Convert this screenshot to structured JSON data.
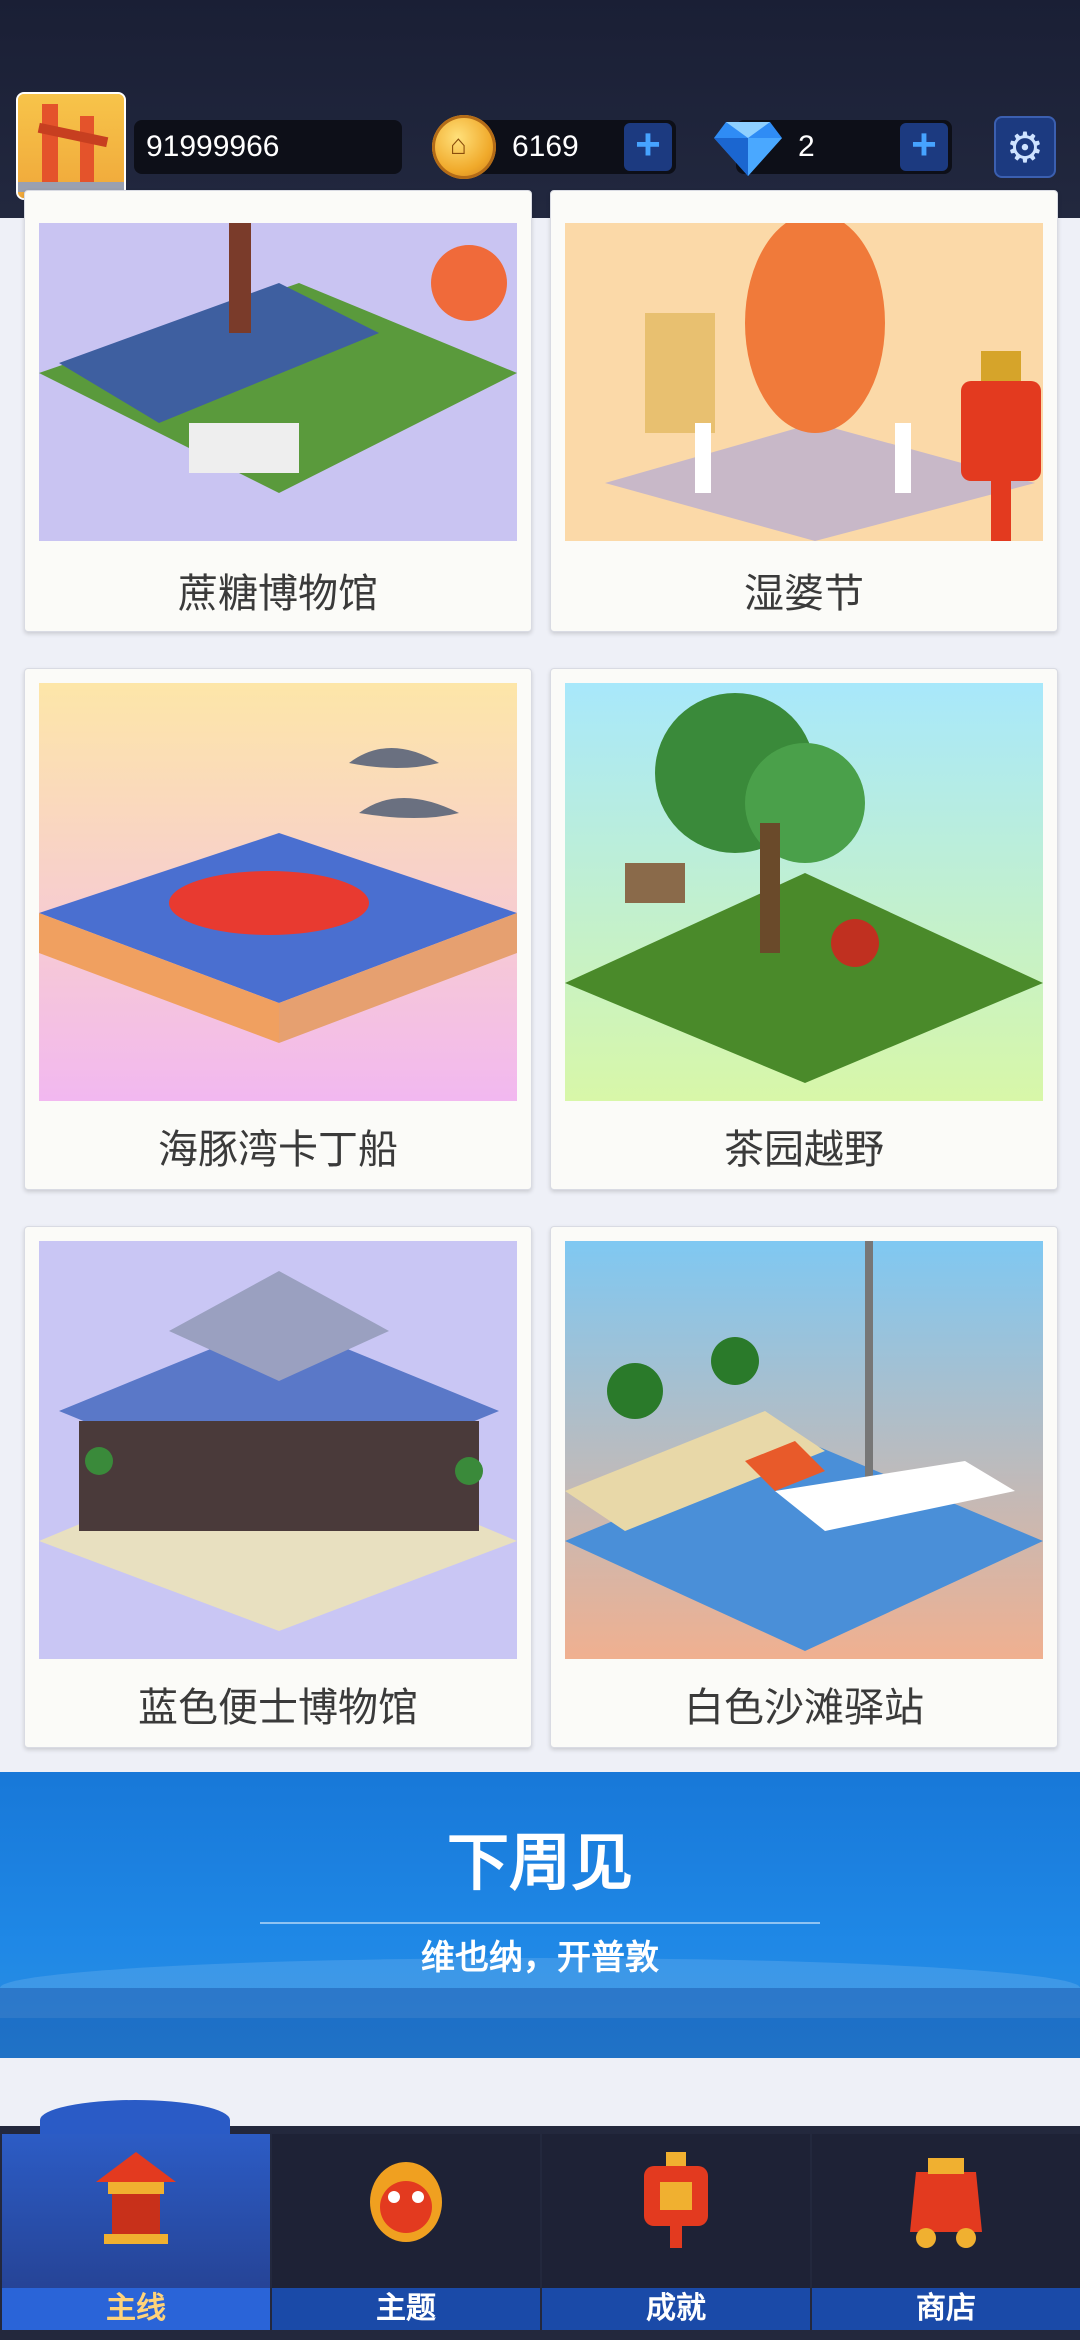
{
  "header": {
    "score": "91999966",
    "coins": "6169",
    "gems": "2",
    "plus_symbol": "+",
    "settings_icon": "gear-icon",
    "avatar_icon": "golden-gate-bridge-icon"
  },
  "cards": [
    {
      "title": "蔗糖博物馆"
    },
    {
      "title": "湿婆节"
    },
    {
      "title": "海豚湾卡丁船"
    },
    {
      "title": "茶园越野"
    },
    {
      "title": "蓝色便士博物馆"
    },
    {
      "title": "白色沙滩驿站"
    }
  ],
  "banner": {
    "title": "下周见",
    "subtitle": "维也纳，开普敦"
  },
  "tabs": [
    {
      "label": "主线",
      "icon": "pagoda-icon"
    },
    {
      "label": "主题",
      "icon": "lion-mask-icon"
    },
    {
      "label": "成就",
      "icon": "fortune-lantern-icon"
    },
    {
      "label": "商店",
      "icon": "gift-bag-icon"
    }
  ],
  "colors": {
    "topbar": "#1a1f35",
    "accent_blue": "#1f88e6",
    "tab_active": "#2a64d8",
    "tab_label_active": "#ffd37a"
  }
}
